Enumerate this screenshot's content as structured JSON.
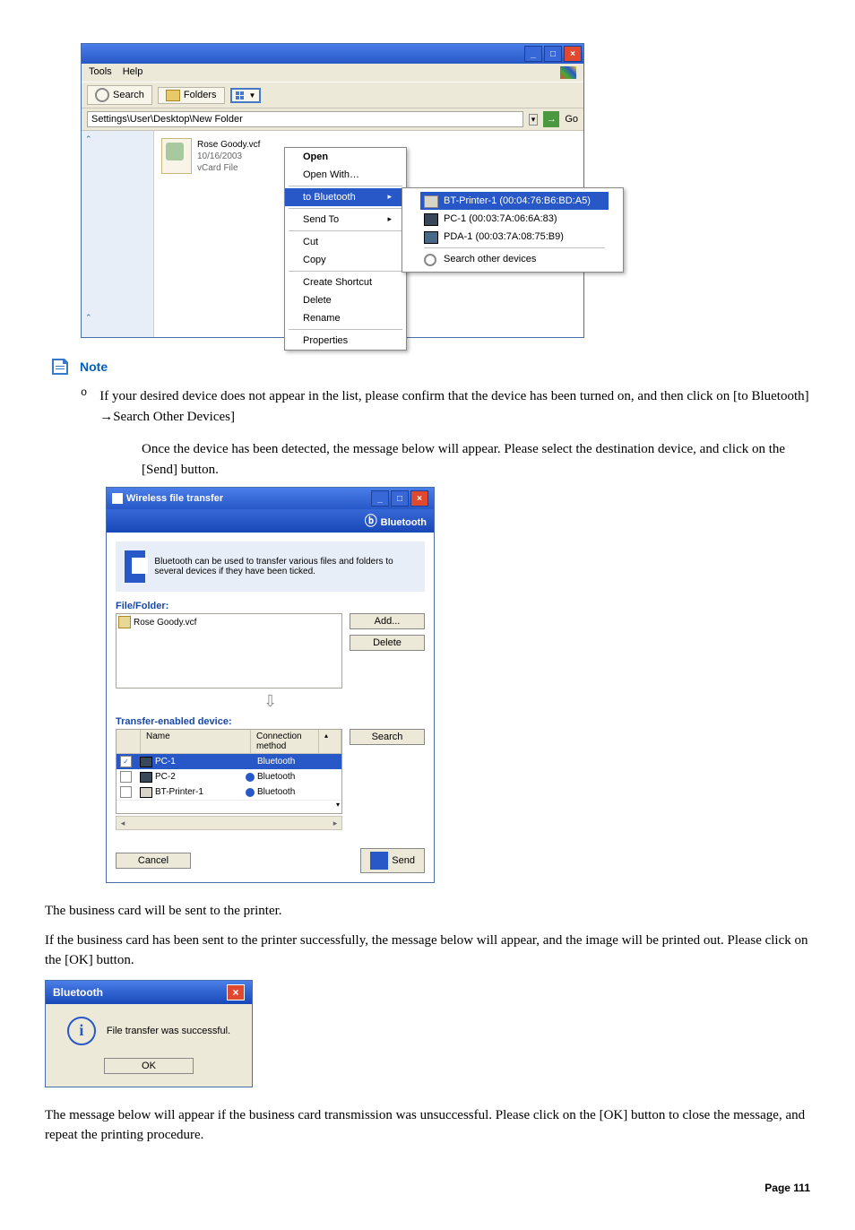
{
  "explorer": {
    "menu": {
      "tools": "Tools",
      "help": "Help"
    },
    "toolbar": {
      "search": "Search",
      "folders": "Folders"
    },
    "address": "Settings\\User\\Desktop\\New Folder",
    "go": "Go",
    "file": {
      "name": "Rose Goody.vcf",
      "date": "10/16/2003",
      "type": "vCard File"
    },
    "context": {
      "open": "Open",
      "openwith": "Open With…",
      "tobluetooth": "to Bluetooth",
      "sendto": "Send To",
      "cut": "Cut",
      "copy": "Copy",
      "shortcut": "Create Shortcut",
      "delete": "Delete",
      "rename": "Rename",
      "properties": "Properties"
    },
    "submenu": {
      "btprinter": "BT-Printer-1 (00:04:76:B6:BD:A5)",
      "pc1": "PC-1 (00:03:7A:06:6A:83)",
      "pda1": "PDA-1 (00:03:7A:08:75:B9)",
      "search": "Search other devices"
    }
  },
  "note": {
    "label": "Note"
  },
  "body": {
    "bullet": "If your desired device does not appear in the list, please confirm that the device has been turned on, and then click on [to Bluetooth] →Search Other Devices]",
    "para": "Once the device has been detected, the message below will appear. Please select the destination device, and click on the [Send] button."
  },
  "wft": {
    "title": "Wireless file transfer",
    "brand": "Bluetooth",
    "info": "Bluetooth can be used to transfer various files and folders to several devices if they have been ticked.",
    "filefolder": "File/Folder:",
    "file": "Rose Goody.vcf",
    "add": "Add...",
    "delete": "Delete",
    "ted": "Transfer-enabled device:",
    "col1": "Name",
    "col2": "Connection method",
    "rows": [
      {
        "name": "PC-1",
        "method": "Bluetooth",
        "checked": true
      },
      {
        "name": "PC-2",
        "method": "Bluetooth",
        "checked": false
      },
      {
        "name": "BT-Printer-1",
        "method": "Bluetooth",
        "checked": false
      }
    ],
    "search": "Search",
    "cancel": "Cancel",
    "send": "Send"
  },
  "txt1": "The business card will be sent to the printer.",
  "txt2": "If the business card has been sent to the printer successfully, the message below will appear, and the image will be printed out. Please click on the [OK] button.",
  "dlg": {
    "title": "Bluetooth",
    "msg": "File transfer was successful.",
    "ok": "OK"
  },
  "txt3": "The message below will appear if the business card transmission was unsuccessful. Please click on the [OK] button to close the message, and repeat the printing procedure.",
  "page": {
    "label": "Page",
    "num": "111"
  }
}
